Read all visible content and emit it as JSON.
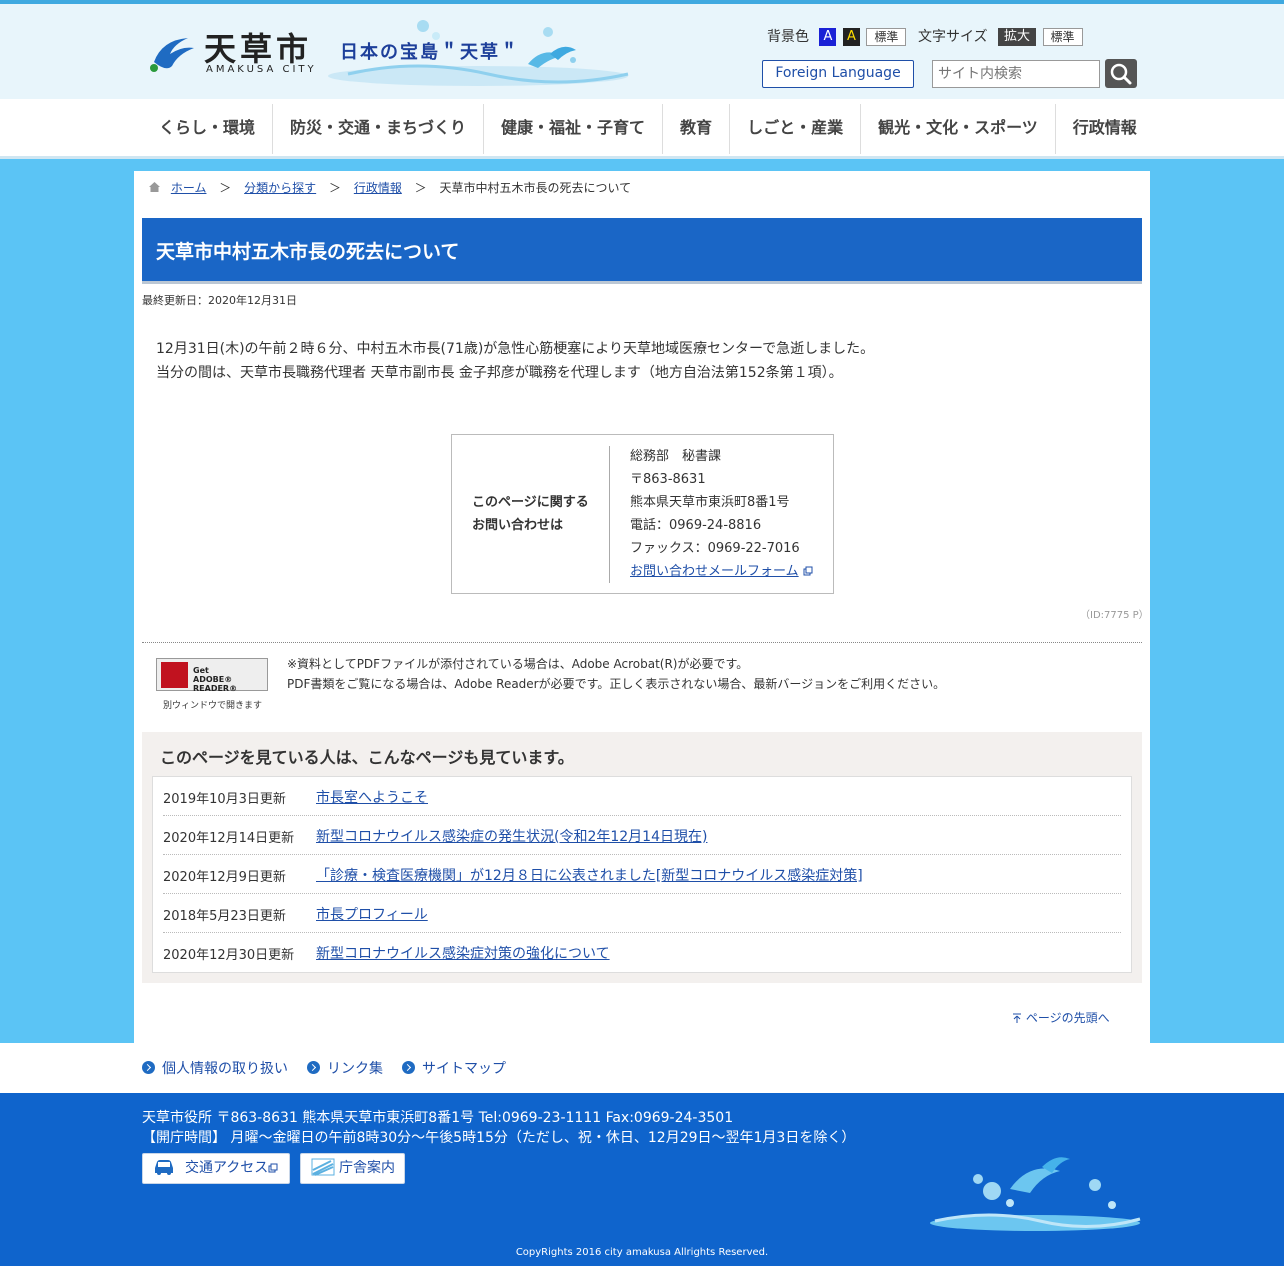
{
  "header": {
    "logo_title": "天草市",
    "logo_sub": "AMAKUSA CITY",
    "catch": "日本の宝島＂天草＂",
    "bg_label": "背景色",
    "bg_blue": "A",
    "bg_black": "A",
    "bg_std": "標準",
    "fs_label": "文字サイズ",
    "fs_big": "拡大",
    "fs_std": "標準",
    "foreign": "Foreign Language",
    "search_placeholder": "サイト内検索"
  },
  "nav": [
    "くらし・環境",
    "防災・交通・まちづくり",
    "健康・福祉・子育て",
    "教育",
    "しごと・産業",
    "観光・文化・スポーツ",
    "行政情報"
  ],
  "breadcrumb": {
    "home": "ホーム",
    "sep": "＞",
    "c1": "分類から探す",
    "c2": "行政情報",
    "current": "天草市中村五木市長の死去について"
  },
  "page": {
    "title": "天草市中村五木市長の死去について",
    "updated": "最終更新日：2020年12月31日",
    "body_1": "12月31日(木)の午前２時６分、中村五木市長(71歳)が急性心筋梗塞により天草地域医療センターで急逝しました。",
    "body_2": "当分の間は、天草市長職務代理者 天草市副市長 金子邦彦が職務を代理します（地方自治法第152条第１項）。",
    "page_id": "（ID:7775 P）"
  },
  "contact": {
    "label_1": "このページに関する",
    "label_2": "お問い合わせは",
    "dept": "総務部　秘書課",
    "zip": "〒863-8631",
    "address": "熊本県天草市東浜町8番1号",
    "tel": "電話：0969-24-8816",
    "fax": "ファックス：0969-22-7016",
    "mail_link": "お問い合わせメールフォーム"
  },
  "pdf": {
    "btn_line1": "Get",
    "btn_line2": "ADOBE® READER®",
    "note": "別ウィンドウで開きます",
    "text_1": "※資料としてPDFファイルが添付されている場合は、Adobe Acrobat(R)が必要です。",
    "text_2": "PDF書類をご覧になる場合は、Adobe Readerが必要です。正しく表示されない場合、最新バージョンをご利用ください。"
  },
  "related": {
    "heading": "このページを見ている人は、こんなページも見ています。",
    "items": [
      {
        "date": "2019年10月3日更新",
        "title": "市長室へようこそ"
      },
      {
        "date": "2020年12月14日更新",
        "title": "新型コロナウイルス感染症の発生状況(令和2年12月14日現在)"
      },
      {
        "date": "2020年12月9日更新",
        "title": "「診療・検査医療機関」が12月８日に公表されました[新型コロナウイルス感染症対策]"
      },
      {
        "date": "2018年5月23日更新",
        "title": "市長プロフィール"
      },
      {
        "date": "2020年12月30日更新",
        "title": "新型コロナウイルス感染症対策の強化について"
      }
    ]
  },
  "pagetop": "ページの先頭へ",
  "footnav": [
    "個人情報の取り扱い",
    "リンク集",
    "サイトマップ"
  ],
  "footer": {
    "address": "天草市役所 〒863-8631  熊本県天草市東浜町8番1号   Tel:0969-23-1111   Fax:0969-24-3501",
    "hours": "【開庁時間】 月曜～金曜日の午前8時30分～午後5時15分（ただし、祝・休日、12月29日～翌年1月3日を除く）",
    "access": "交通アクセス",
    "guide": "庁舎案内",
    "copyright": "CopyRights 2016 city amakusa Allrights Reserved."
  },
  "colors": {
    "accent": "#1a66c6",
    "background": "#5bc4f5",
    "footer": "#0f64cc"
  }
}
